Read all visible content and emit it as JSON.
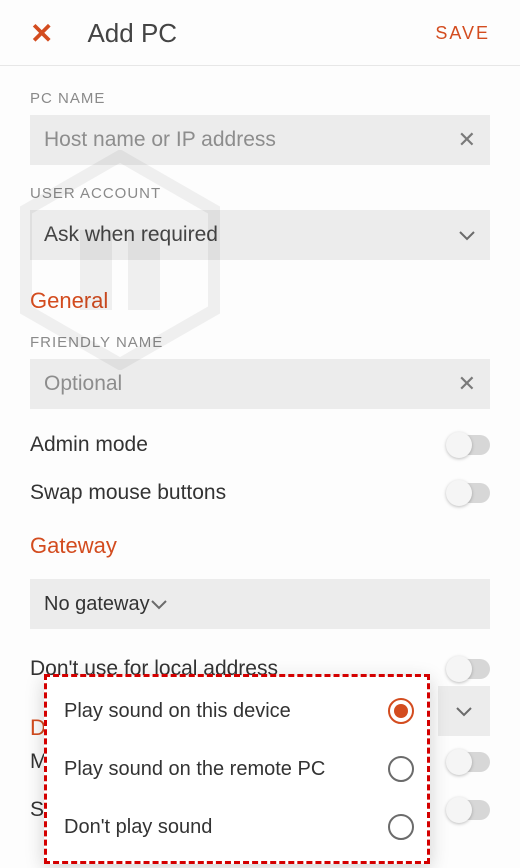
{
  "header": {
    "title": "Add PC",
    "save": "SAVE"
  },
  "pc_name": {
    "label": "PC NAME",
    "placeholder": "Host name or IP address"
  },
  "user_account": {
    "label": "USER ACCOUNT",
    "value": "Ask when required"
  },
  "general": {
    "title": "General",
    "friendly_name_label": "FRIENDLY NAME",
    "friendly_name_placeholder": "Optional",
    "admin_mode": "Admin mode",
    "swap_mouse": "Swap mouse buttons"
  },
  "gateway": {
    "title": "Gateway",
    "value": "No gateway",
    "local_addr": "Don't use for local address"
  },
  "audio": {
    "title": "Device & Audio Redirection",
    "options": [
      "Play sound on this device",
      "Play sound on the remote PC",
      "Don't play sound"
    ],
    "selected_index": 0
  },
  "partials": {
    "m": "M",
    "s": "S"
  }
}
